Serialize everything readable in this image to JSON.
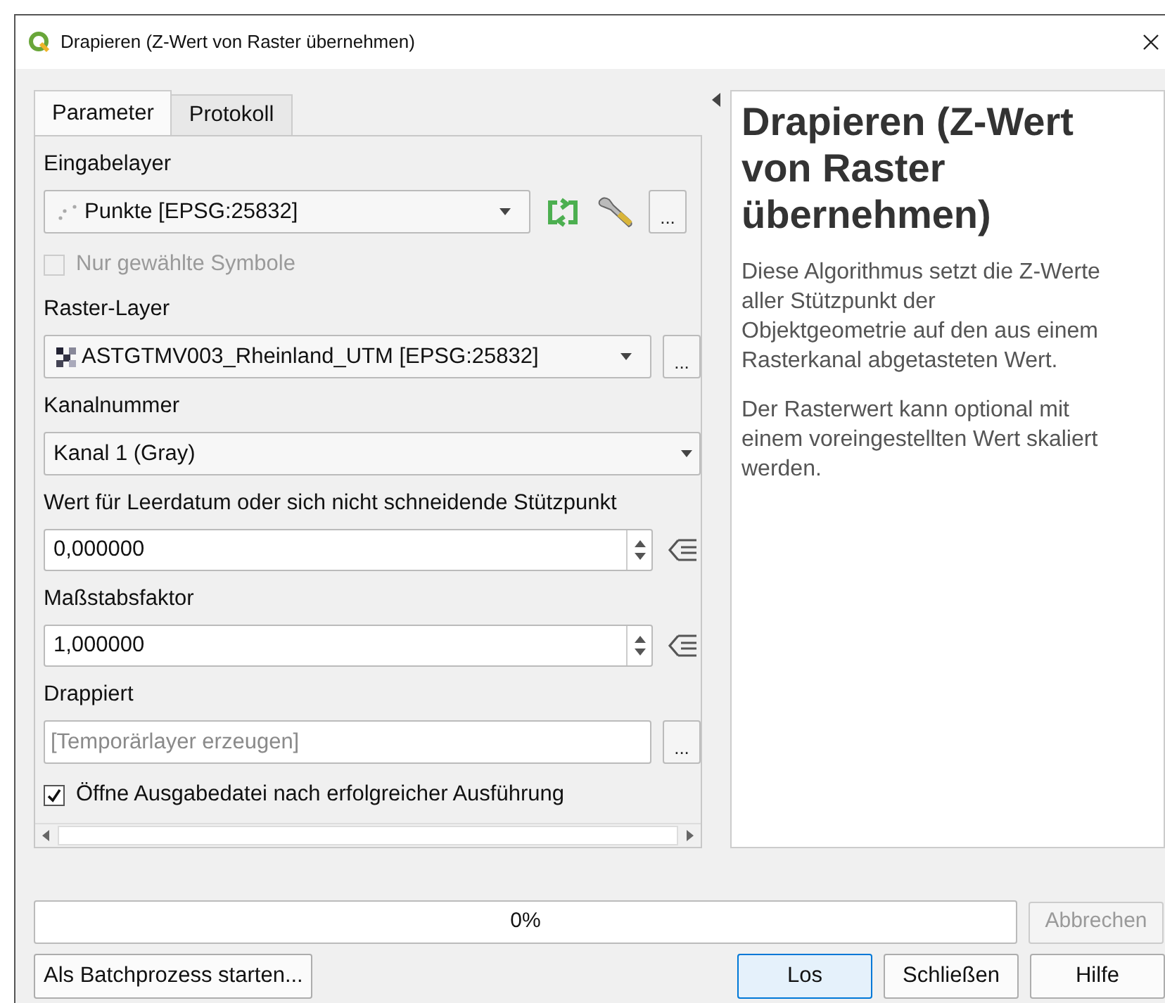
{
  "window": {
    "title": "Drapieren (Z-Wert von Raster übernehmen)"
  },
  "tabs": [
    {
      "label": "Parameter",
      "selected": true
    },
    {
      "label": "Protokoll",
      "selected": false
    }
  ],
  "parameters": [
    {
      "kind": "vector_layer",
      "label": "Eingabelayer",
      "value": "Punkte [EPSG:25832]",
      "button": "..."
    },
    {
      "kind": "checkbox",
      "label": "Nur gewählte Symbole",
      "checked": false,
      "disabled": true
    },
    {
      "kind": "raster_layer",
      "label": "Raster-Layer",
      "value": "ASTGTMV003_Rheinland_UTM [EPSG:25832]",
      "button": "..."
    },
    {
      "kind": "band",
      "label": "Kanalnummer",
      "value": "Kanal 1 (Gray)"
    },
    {
      "kind": "number",
      "label": "Wert für Leerdatum oder sich nicht schneidende Stützpunkt",
      "value": "0,000000"
    },
    {
      "kind": "number",
      "label": "Maßstabsfaktor",
      "value": "1,000000"
    },
    {
      "kind": "output",
      "label": "Drappiert",
      "placeholder": "[Temporärlayer erzeugen]",
      "button": "..."
    },
    {
      "kind": "checkbox",
      "label": "Öffne Ausgabedatei nach erfolgreicher Ausführung",
      "checked": true,
      "disabled": false
    }
  ],
  "help": {
    "title": "Drapieren (Z-Wert von Raster übernehmen)",
    "paragraphs": [
      "Diese Algorithmus setzt die Z-Werte aller Stützpunkt der Objektgeometrie auf den aus einem Rasterkanal abgetasteten Wert.",
      "Der Rasterwert kann optional mit einem voreingestellten Wert skaliert werden."
    ]
  },
  "progress": {
    "level": 0,
    "text": "0%"
  },
  "cancel_button": {
    "label": "Abbrechen",
    "disabled": true
  },
  "buttons": [
    {
      "label": "Als Batchprozess starten...",
      "default": false
    },
    {
      "label": "Los",
      "default": true
    },
    {
      "label": "Schließen",
      "default": false
    },
    {
      "label": "Hilfe",
      "default": false
    }
  ]
}
